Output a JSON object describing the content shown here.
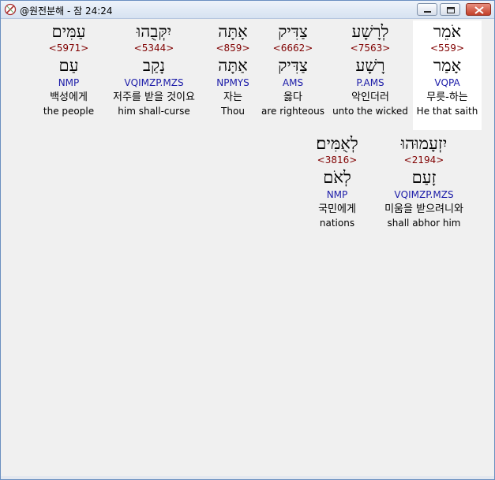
{
  "window": {
    "title": "@원전분해 - 잠 24:24",
    "buttons": {
      "minimize": "minimize-icon",
      "maximize": "maximize-icon",
      "close": "close-icon"
    }
  },
  "rows": [
    {
      "words": [
        {
          "hebrew": "אֹמֵר",
          "strong": "<559>",
          "lemma": "אָמַר",
          "parsing": "VQPA",
          "korean": "무릇-하는",
          "english": "He that saith",
          "selected": true
        },
        {
          "hebrew": "לְרָשָׁע",
          "strong": "<7563>",
          "lemma": "רָשָׁע",
          "parsing": "P.AMS",
          "korean": "악인더러",
          "english": "unto the wicked"
        },
        {
          "hebrew": "צַדִּיק",
          "strong": "<6662>",
          "lemma": "צַדִּיק",
          "parsing": "AMS",
          "korean": "옳다",
          "english": "are righteous"
        },
        {
          "hebrew": "אָתָּה",
          "strong": "<859>",
          "lemma": "אַתָּה",
          "parsing": "NPMYS",
          "korean": "자는",
          "english": "Thou"
        },
        {
          "hebrew": "יִקְּבֻהוּ",
          "strong": "<5344>",
          "lemma": "נָקַב",
          "parsing": "VQIMZP.MZS",
          "korean": "저주를 받을 것이요",
          "english": "him shall-curse"
        },
        {
          "hebrew": "עַמִּים",
          "strong": "<5971>",
          "lemma": "עַם",
          "parsing": "NMP",
          "korean": "백성에게",
          "english": "the people"
        }
      ]
    },
    {
      "words": [
        {
          "hebrew": "יִזְעָמוּהוּ",
          "strong": "<2194>",
          "lemma": "זָעַם",
          "parsing": "VQIMZP.MZS",
          "korean": "미움을 받으려니와",
          "english": "shall abhor him"
        },
        {
          "hebrew": "לְאֻמִּים׃",
          "strong": "<3816>",
          "lemma": "לְאֹם",
          "parsing": "NMP",
          "korean": "국민에게",
          "english": "nations"
        }
      ]
    }
  ]
}
